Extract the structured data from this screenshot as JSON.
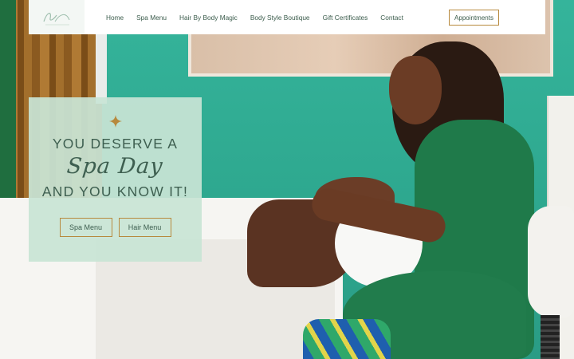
{
  "header": {
    "logo_text": "Body Magic",
    "nav": [
      {
        "label": "Home"
      },
      {
        "label": "Spa Menu"
      },
      {
        "label": "Hair By Body Magic"
      },
      {
        "label": "Body Style Boutique"
      },
      {
        "label": "Gift Certificates"
      },
      {
        "label": "Contact"
      }
    ],
    "cta_label": "Appointments"
  },
  "hero": {
    "line1": "YOU DESERVE A",
    "script": "Spa Day",
    "line2": "AND YOU KNOW IT!",
    "buttons": [
      {
        "label": "Spa Menu"
      },
      {
        "label": "Hair Menu"
      }
    ]
  },
  "icons": {
    "sparkle": "sparkle-icon",
    "logo": "logo-icon"
  },
  "colors": {
    "accent_gold": "#b7893d",
    "text_green": "#3e5f50",
    "card_bg": "#c8e4d5",
    "wall_teal": "#2fa892"
  }
}
